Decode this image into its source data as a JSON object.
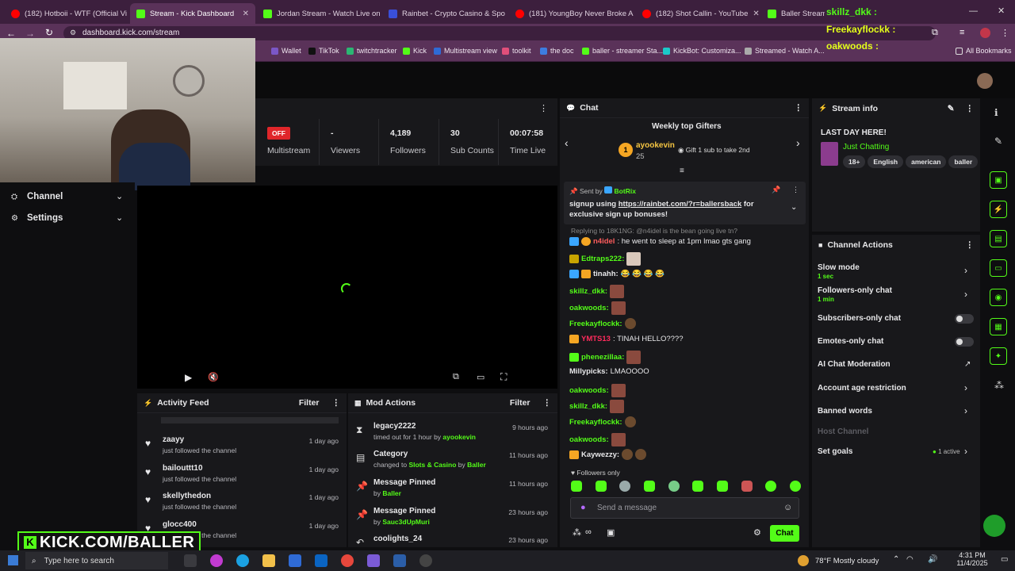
{
  "browser": {
    "tabs": [
      {
        "title": "(182) Hotboii - WTF (Official Vi",
        "color": "#ff0000"
      },
      {
        "title": "Stream - Kick Dashboard",
        "color": "#53fc18",
        "active": true
      },
      {
        "title": "Jordan Stream - Watch Live on",
        "color": "#53fc18"
      },
      {
        "title": "Rainbet - Crypto Casino & Spo",
        "color": "#3a4fd8"
      },
      {
        "title": "(181) YoungBoy Never Broke A",
        "color": "#ff0000"
      },
      {
        "title": "(182) Shot Callin - YouTube",
        "color": "#ff0000"
      },
      {
        "title": "Baller Stream - W",
        "color": "#53fc18"
      }
    ],
    "address": "dashboard.kick.com/stream",
    "bookmarks": [
      "Wallet",
      "TikTok",
      "twitchtracker",
      "Kick",
      "Multistream view",
      "toolkit",
      "the doc",
      "baller - streamer Sta...",
      "KickBot: Customiza...",
      "Streamed - Watch A..."
    ],
    "all_bookmarks": "All Bookmarks"
  },
  "overlay_chat": [
    {
      "user": "skillz_dkk :"
    },
    {
      "user": "Freekayflockk :"
    },
    {
      "user": "oakwoods :"
    }
  ],
  "sidebar": {
    "items": [
      {
        "label": "Channel",
        "icon": "channel-icon"
      },
      {
        "label": "Settings",
        "icon": "gear-icon"
      }
    ]
  },
  "stats": [
    {
      "value": "OFF",
      "label": "Multistream"
    },
    {
      "value": "-",
      "label": "Viewers"
    },
    {
      "value": "4,189",
      "label": "Followers"
    },
    {
      "value": "30",
      "label": "Sub Counts"
    },
    {
      "value": "00:07:58",
      "label": "Time Live"
    }
  ],
  "activity_feed": {
    "title": "Activity Feed",
    "filter": "Filter",
    "items": [
      {
        "name": "zaayy",
        "action": "just followed the channel",
        "time": "1 day ago"
      },
      {
        "name": "bailouttt10",
        "action": "just followed the channel",
        "time": "1 day ago"
      },
      {
        "name": "skellythedon",
        "action": "just followed the channel",
        "time": "1 day ago"
      },
      {
        "name": "glocc400",
        "action": "just followed the channel",
        "time": "1 day ago"
      }
    ]
  },
  "mod_actions": {
    "title": "Mod Actions",
    "filter": "Filter",
    "items": [
      {
        "name": "legacy2222",
        "detail_prefix": "timed out for 1 hour by ",
        "detail_user": "ayookevin",
        "time": "9 hours ago",
        "icon": "hourglass-icon"
      },
      {
        "name": "Category",
        "detail_prefix": "changed to ",
        "detail_user": "Slots & Casino",
        "detail_suffix": " by ",
        "detail_user2": "Baller",
        "time": "11 hours ago",
        "icon": "calendar-icon"
      },
      {
        "name": "Message Pinned",
        "detail_prefix": "by ",
        "detail_user": "Baller",
        "time": "11 hours ago",
        "icon": "pin-icon"
      },
      {
        "name": "Message Pinned",
        "detail_prefix": "by ",
        "detail_user": "Sauc3dUpMuri",
        "time": "23 hours ago",
        "icon": "pin-icon"
      },
      {
        "name": "coolights_24",
        "detail_prefix": "",
        "detail_user": "",
        "time": "23 hours ago",
        "icon": "undo-icon"
      }
    ]
  },
  "chat": {
    "title": "Chat",
    "gifters_title": "Weekly top Gifters",
    "top_gifter": {
      "rank": "1",
      "name": "ayookevin",
      "count": "25"
    },
    "gift_hint": "Gift 1 sub to take 2nd",
    "pinned": {
      "sent_by": "Sent by",
      "bot": "BotRix",
      "text_prefix": "signup using ",
      "link": "https://rainbet.com/?r=ballersback",
      "text_suffix": " for exclusive sign up bonuses!"
    },
    "reply_line": "Replying to 18K1NG: @n4idel is the bean going live tn?",
    "messages": [
      {
        "user": "n4idel",
        "color": "#ff5c5c",
        "text": ": he went to sleep at 1pm lmao gts gang"
      },
      {
        "user": "Edtraps222:",
        "color": "#53fc18",
        "text": ""
      },
      {
        "user": "tinahh:",
        "color": "#e8e8ea",
        "text": "😂 😂 😂 😂"
      },
      {
        "user": "skillz_dkk:",
        "color": "#53fc18",
        "text": ""
      },
      {
        "user": "oakwoods:",
        "color": "#53fc18",
        "text": ""
      },
      {
        "user": "Freekayflockk:",
        "color": "#53fc18",
        "text": ""
      },
      {
        "user": "YMTS13",
        "color": "#ff2b5c",
        "text": ": TINAH HELLO????"
      },
      {
        "user": "phenezillaa:",
        "color": "#53fc18",
        "text": ""
      },
      {
        "user": "Millypicks:",
        "color": "#e8e8ea",
        "text": " LMAOOOO"
      },
      {
        "user": "oakwoods:",
        "color": "#53fc18",
        "text": ""
      },
      {
        "user": "skillz_dkk:",
        "color": "#53fc18",
        "text": ""
      },
      {
        "user": "Freekayflockk:",
        "color": "#53fc18",
        "text": ""
      },
      {
        "user": "oakwoods:",
        "color": "#53fc18",
        "text": ""
      },
      {
        "user": "Kaywezzy:",
        "color": "#e8e8ea",
        "text": ""
      }
    ],
    "followers_only": "Followers only",
    "input_placeholder": "Send a message",
    "send_label": "Chat"
  },
  "stream_info": {
    "title": "Stream info",
    "stream_title": "LAST DAY HERE!",
    "category": "Just Chatting",
    "tags": [
      "18+",
      "English",
      "american",
      "baller"
    ]
  },
  "channel_actions": {
    "title": "Channel Actions",
    "items": [
      {
        "label": "Slow mode",
        "sub": "1 sec",
        "control": "chevron"
      },
      {
        "label": "Followers-only chat",
        "sub": "1 min",
        "control": "chevron"
      },
      {
        "label": "Subscribers-only chat",
        "sub": "",
        "control": "toggle"
      },
      {
        "label": "Emotes-only chat",
        "sub": "",
        "control": "toggle"
      },
      {
        "label": "AI Chat Moderation",
        "sub": "",
        "control": "external"
      },
      {
        "label": "Account age restriction",
        "sub": "",
        "control": "chevron"
      },
      {
        "label": "Banned words",
        "sub": "",
        "control": "chevron"
      },
      {
        "label": "Host Channel",
        "sub": "",
        "control": "none",
        "disabled": true
      },
      {
        "label": "Set goals",
        "sub": "",
        "control": "chevron",
        "status": "1 active"
      }
    ]
  },
  "watermark": "KICK.COM/BALLER",
  "taskbar": {
    "search_placeholder": "Type here to search",
    "weather": "78°F  Mostly cloudy",
    "time": "4:31 PM",
    "date": "11/4/2025"
  },
  "colors": {
    "accent": "#53fc18",
    "browser": "#5a3259",
    "panel": "#18181b"
  }
}
